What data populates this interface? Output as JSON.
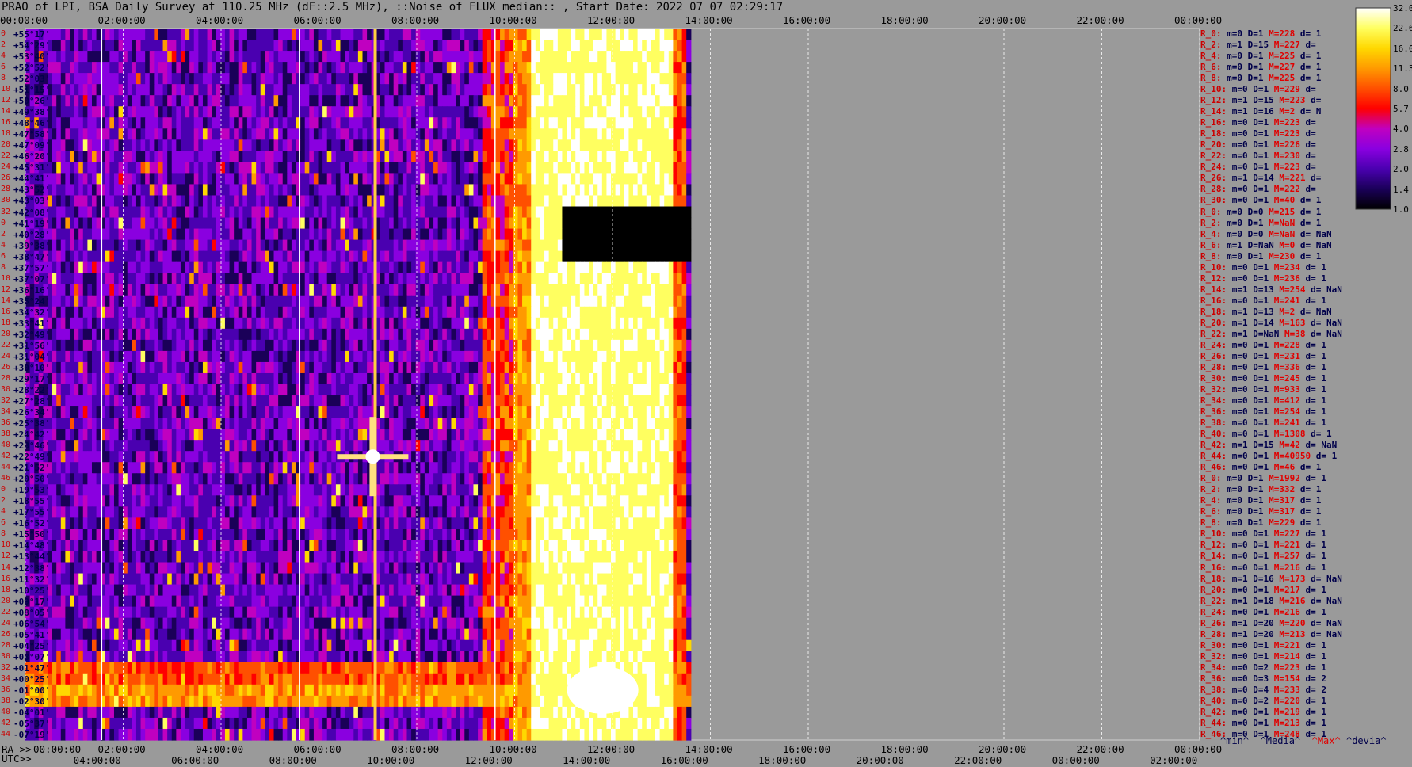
{
  "title": "PRAO of LPI, BSA Daily Survey at 110.25 MHz (dF::2.5 MHz), ::Noise_of_FLUX_median:: , Start Date: 2022 07 07 02:29:17",
  "top_axis": [
    "00:00:00",
    "02:00:00",
    "04:00:00",
    "06:00:00",
    "08:00:00",
    "10:00:00",
    "12:00:00",
    "14:00:00",
    "16:00:00",
    "18:00:00",
    "20:00:00",
    "22:00:00",
    "00:00:00"
  ],
  "bottom_axis_ra_label": "RA >>",
  "bottom_axis_ra": [
    "00:00:00",
    "02:00:00",
    "04:00:00",
    "06:00:00",
    "08:00:00",
    "10:00:00",
    "12:00:00",
    "14:00:00",
    "16:00:00",
    "18:00:00",
    "20:00:00",
    "22:00:00",
    "00:00:00"
  ],
  "bottom_axis_utc_label": "UTC>>",
  "bottom_axis_utc": [
    "04:00:00",
    "06:00:00",
    "08:00:00",
    "10:00:00",
    "12:00:00",
    "14:00:00",
    "16:00:00",
    "18:00:00",
    "20:00:00",
    "22:00:00",
    "00:00:00",
    "02:00:00"
  ],
  "declinations": [
    "+55°17'",
    "+54°29'",
    "+53°40'",
    "+52°52'",
    "+52°03'",
    "+51°15'",
    "+50°26'",
    "+49°38'",
    "+48°46'",
    "+47°58'",
    "+47°09'",
    "+46°20'",
    "+45°31'",
    "+44°41'",
    "+43°52'",
    "+43°03'",
    "+42°08'",
    "+41°19'",
    "+40°28'",
    "+39°38'",
    "+38°47'",
    "+37°57'",
    "+37°07'",
    "+36°16'",
    "+35°24'",
    "+34°32'",
    "+33°41'",
    "+32°49'",
    "+31°56'",
    "+31°04'",
    "+30°10'",
    "+29°17'",
    "+28°22'",
    "+27°28'",
    "+26°34'",
    "+25°38'",
    "+24°42'",
    "+23°46'",
    "+22°49'",
    "+21°52'",
    "+20°50'",
    "+19°53'",
    "+18°55'",
    "+17°55'",
    "+16°52'",
    "+15°50'",
    "+14°48'",
    "+13°44'",
    "+12°38'",
    "+11°32'",
    "+10°25'",
    "+09°17'",
    "+08°05'",
    "+06°54'",
    "+05°41'",
    "+04°25'",
    "+03°07'",
    "+01°47'",
    "+00°25'",
    "-01°00'",
    "-02°30'",
    "-04°01'",
    "-05°37'",
    "-07°19'"
  ],
  "beam_indices": [
    "0",
    "2",
    "4",
    "6",
    "8",
    "10",
    "12",
    "14",
    "16",
    "18",
    "20",
    "22",
    "24",
    "26",
    "28",
    "30",
    "32",
    "0",
    "2",
    "4",
    "6",
    "8",
    "10",
    "12",
    "14",
    "16",
    "18",
    "20",
    "22",
    "24",
    "26",
    "28",
    "30",
    "32",
    "34",
    "36",
    "38",
    "40",
    "42",
    "44",
    "46",
    "0",
    "2",
    "4",
    "6",
    "8",
    "10",
    "12",
    "14",
    "16",
    "18",
    "20",
    "22",
    "24",
    "26",
    "28",
    "30",
    "32",
    "34",
    "36",
    "38",
    "40",
    "42",
    "44",
    "46"
  ],
  "stats": [
    [
      "R_0:",
      "m=0",
      "D=1",
      "M=228",
      "d= 1"
    ],
    [
      "R_2:",
      "m=1",
      "D=15",
      "M=227",
      "d="
    ],
    [
      "R_4:",
      "m=0",
      "D=1",
      "M=225",
      "d= 1"
    ],
    [
      "R_6:",
      "m=0",
      "D=1",
      "M=227",
      "d= 1"
    ],
    [
      "R_8:",
      "m=0",
      "D=1",
      "M=225",
      "d= 1"
    ],
    [
      "R_10:",
      "m=0",
      "D=1",
      "M=229",
      "d="
    ],
    [
      "R_12:",
      "m=1",
      "D=15",
      "M=223",
      "d="
    ],
    [
      "R_14:",
      "m=1",
      "D=16",
      "M=2",
      "d= N"
    ],
    [
      "R_16:",
      "m=0",
      "D=1",
      "M=223",
      "d="
    ],
    [
      "R_18:",
      "m=0",
      "D=1",
      "M=223",
      "d="
    ],
    [
      "R_20:",
      "m=0",
      "D=1",
      "M=226",
      "d="
    ],
    [
      "R_22:",
      "m=0",
      "D=1",
      "M=230",
      "d="
    ],
    [
      "R_24:",
      "m=0",
      "D=1",
      "M=223",
      "d="
    ],
    [
      "R_26:",
      "m=1",
      "D=14",
      "M=221",
      "d="
    ],
    [
      "R_28:",
      "m=0",
      "D=1",
      "M=222",
      "d="
    ],
    [
      "R_30:",
      "m=0",
      "D=1",
      "M=40",
      "d= 1"
    ],
    [
      "R_0:",
      "m=0",
      "D=0",
      "M=215",
      "d= 1"
    ],
    [
      "R_2:",
      "m=0",
      "D=1",
      "M=NaN",
      "d= 1"
    ],
    [
      "R_4:",
      "m=0",
      "D=0",
      "M=NaN",
      "d= NaN"
    ],
    [
      "R_6:",
      "m=1",
      "D=NaN",
      "M=0",
      "d= NaN"
    ],
    [
      "R_8:",
      "m=0",
      "D=1",
      "M=230",
      "d= 1"
    ],
    [
      "R_10:",
      "m=0",
      "D=1",
      "M=234",
      "d= 1"
    ],
    [
      "R_12:",
      "m=0",
      "D=1",
      "M=236",
      "d= 1"
    ],
    [
      "R_14:",
      "m=1",
      "D=13",
      "M=254",
      "d= NaN"
    ],
    [
      "R_16:",
      "m=0",
      "D=1",
      "M=241",
      "d= 1"
    ],
    [
      "R_18:",
      "m=1",
      "D=13",
      "M=2",
      "d= NaN"
    ],
    [
      "R_20:",
      "m=1",
      "D=14",
      "M=163",
      "d= NaN"
    ],
    [
      "R_22:",
      "m=1",
      "D=NaN",
      "M=38",
      "d= NaN"
    ],
    [
      "R_24:",
      "m=0",
      "D=1",
      "M=228",
      "d= 1"
    ],
    [
      "R_26:",
      "m=0",
      "D=1",
      "M=231",
      "d= 1"
    ],
    [
      "R_28:",
      "m=0",
      "D=1",
      "M=336",
      "d= 1"
    ],
    [
      "R_30:",
      "m=0",
      "D=1",
      "M=245",
      "d= 1"
    ],
    [
      "R_32:",
      "m=0",
      "D=1",
      "M=933",
      "d= 1"
    ],
    [
      "R_34:",
      "m=0",
      "D=1",
      "M=412",
      "d= 1"
    ],
    [
      "R_36:",
      "m=0",
      "D=1",
      "M=254",
      "d= 1"
    ],
    [
      "R_38:",
      "m=0",
      "D=1",
      "M=241",
      "d= 1"
    ],
    [
      "R_40:",
      "m=0",
      "D=1",
      "M=1308",
      "d= 1"
    ],
    [
      "R_42:",
      "m=1",
      "D=15",
      "M=42",
      "d= NaN"
    ],
    [
      "R_44:",
      "m=0",
      "D=1",
      "M=40950",
      "d= 1"
    ],
    [
      "R_46:",
      "m=0",
      "D=1",
      "M=46",
      "d= 1"
    ],
    [
      "R_0:",
      "m=0",
      "D=1",
      "M=1992",
      "d= 1"
    ],
    [
      "R_2:",
      "m=0",
      "D=1",
      "M=332",
      "d= 1"
    ],
    [
      "R_4:",
      "m=0",
      "D=1",
      "M=317",
      "d= 1"
    ],
    [
      "R_6:",
      "m=0",
      "D=1",
      "M=317",
      "d= 1"
    ],
    [
      "R_8:",
      "m=0",
      "D=1",
      "M=229",
      "d= 1"
    ],
    [
      "R_10:",
      "m=0",
      "D=1",
      "M=227",
      "d= 1"
    ],
    [
      "R_12:",
      "m=0",
      "D=1",
      "M=221",
      "d= 1"
    ],
    [
      "R_14:",
      "m=0",
      "D=1",
      "M=257",
      "d= 1"
    ],
    [
      "R_16:",
      "m=0",
      "D=1",
      "M=216",
      "d= 1"
    ],
    [
      "R_18:",
      "m=1",
      "D=16",
      "M=173",
      "d= NaN"
    ],
    [
      "R_20:",
      "m=0",
      "D=1",
      "M=217",
      "d= 1"
    ],
    [
      "R_22:",
      "m=1",
      "D=18",
      "M=216",
      "d= NaN"
    ],
    [
      "R_24:",
      "m=0",
      "D=1",
      "M=216",
      "d= 1"
    ],
    [
      "R_26:",
      "m=1",
      "D=20",
      "M=220",
      "d= NaN"
    ],
    [
      "R_28:",
      "m=1",
      "D=20",
      "M=213",
      "d= NaN"
    ],
    [
      "R_30:",
      "m=0",
      "D=1",
      "M=221",
      "d= 1"
    ],
    [
      "R_32:",
      "m=0",
      "D=1",
      "M=214",
      "d= 1"
    ],
    [
      "R_34:",
      "m=0",
      "D=2",
      "M=223",
      "d= 1"
    ],
    [
      "R_36:",
      "m=0",
      "D=3",
      "M=154",
      "d= 2"
    ],
    [
      "R_38:",
      "m=0",
      "D=4",
      "M=233",
      "d= 2"
    ],
    [
      "R_40:",
      "m=0",
      "D=2",
      "M=220",
      "d= 1"
    ],
    [
      "R_42:",
      "m=0",
      "D=1",
      "M=219",
      "d= 1"
    ],
    [
      "R_44:",
      "m=0",
      "D=1",
      "M=213",
      "d= 1"
    ],
    [
      "R_46:",
      "m=0",
      "D=1",
      "M=248",
      "d= 1"
    ]
  ],
  "legend_row": {
    "min": "^min^",
    "median": "^Media^",
    "max": "^Max^",
    "dev": "^devia^"
  },
  "colors": {
    "plot_bg": "#000000",
    "page_bg": "#9a9a9a",
    "index_red": "#cc0000",
    "stat_red": "#e00000",
    "stat_blue": "#00004a"
  },
  "chart_data": {
    "type": "heatmap",
    "xlabel": "RA / UTC",
    "ylabel": "",
    "x_range_hours": [
      0,
      24
    ],
    "x_data_extent_hours": [
      0,
      13.6
    ],
    "colorbar": {
      "scale": "log",
      "ticks": [
        32.0,
        22.6,
        16.0,
        11.3,
        8.0,
        5.7,
        4.0,
        2.8,
        2.0,
        1.4,
        1.0
      ],
      "colormap": [
        "#000000",
        "#1a0058",
        "#4a00b0",
        "#8a00e0",
        "#c000c0",
        "#ff0000",
        "#ff5000",
        "#ff9a00",
        "#ffd800",
        "#ffff60",
        "#ffffff"
      ]
    },
    "features": [
      {
        "kind": "vertical_band",
        "ra_start": 9.9,
        "ra_end": 13.5,
        "level": "high"
      },
      {
        "kind": "horizontal_band",
        "dec_start": "+01°47'",
        "dec_end": "-02°30'",
        "level": "high"
      },
      {
        "kind": "vertical_line",
        "ra": 7.15,
        "level": "high"
      },
      {
        "kind": "point_source",
        "ra": 7.1,
        "dec": "+22°49'",
        "level": "max"
      },
      {
        "kind": "gap",
        "ra_start": 10.9,
        "ra_end": 13.6,
        "dec_start": "+42°08'",
        "dec_end": "+38°47'"
      }
    ]
  }
}
